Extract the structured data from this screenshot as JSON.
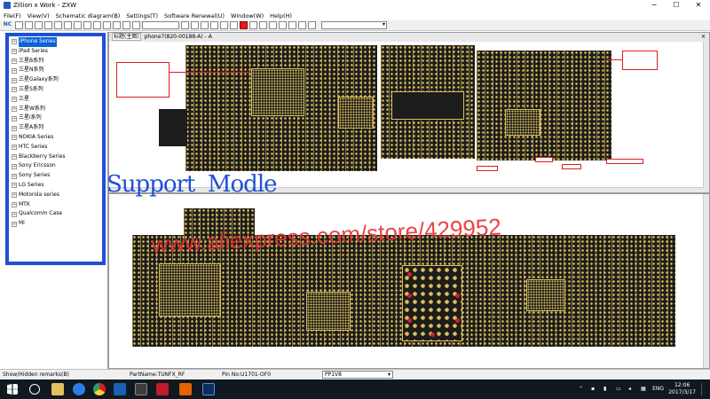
{
  "window": {
    "title": "Zillion x Work - ZXW",
    "controls": {
      "minimize": "─",
      "maximize": "☐",
      "close": "✕"
    }
  },
  "menu": [
    "File(F)",
    "View(V)",
    "Schematic diagram(B)",
    "Settings(T)",
    "Software Renewal(U)",
    "Window(W)",
    "Help(H)"
  ],
  "toolbar": {
    "nc_label": "NC"
  },
  "tree": {
    "items": [
      {
        "label": "iPhone Series",
        "selected": true
      },
      {
        "label": "iPad Series"
      },
      {
        "label": "三星B系列"
      },
      {
        "label": "三星N系列"
      },
      {
        "label": "三星Galaxy系列"
      },
      {
        "label": "三星S系列"
      },
      {
        "label": "三星"
      },
      {
        "label": "三星W系列"
      },
      {
        "label": "三星i系列"
      },
      {
        "label": "三星A系列"
      },
      {
        "label": "NOKIA Series"
      },
      {
        "label": "HTC Series"
      },
      {
        "label": "Blackberry Series"
      },
      {
        "label": "Sony Ericsson"
      },
      {
        "label": "Sony Series"
      },
      {
        "label": "LG Series"
      },
      {
        "label": "Motorola series"
      },
      {
        "label": "MTK"
      },
      {
        "label": "Qualcomm Case"
      },
      {
        "label": "Mi"
      }
    ]
  },
  "overlay": {
    "support_text": "Support  Modle",
    "store_url": "www.aliexpress.com/store/429952"
  },
  "documents": [
    {
      "tab_title": "phone7(820-00188-A) - A",
      "prefix_chip": "标题(主图)"
    },
    {
      "tab_title": ""
    }
  ],
  "statusbar": {
    "remarks": "Show/Hidden remarks(B)",
    "part_name": "PartName:TUNFX_RF",
    "pin_no": "Pin No:U1701-OF0",
    "net": "PP1V8"
  },
  "taskbar": {
    "lang": "ENG",
    "time": "12:06",
    "date": "2017/3/17"
  },
  "colors": {
    "accent_blue": "#1f4fd8",
    "board_gold": "#d9bd5a",
    "board_black": "#1d1d1d",
    "highlight_red": "#e01b24",
    "taskbar": "#101820"
  }
}
